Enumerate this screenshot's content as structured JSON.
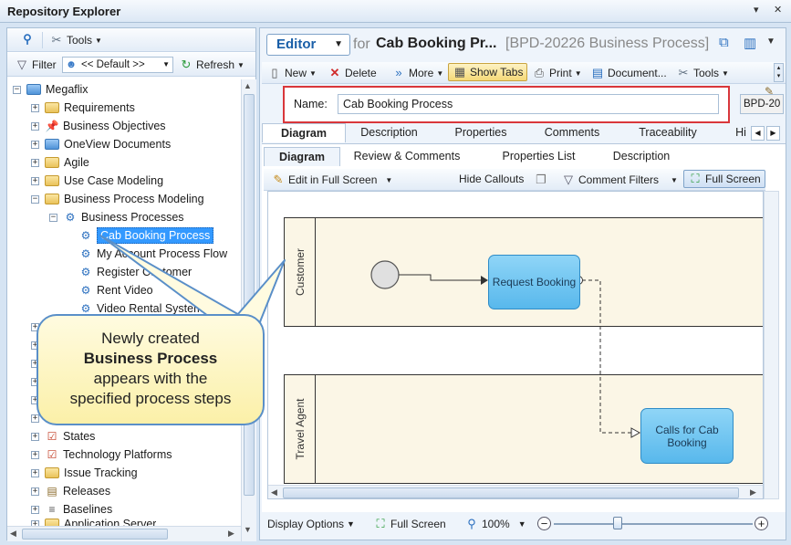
{
  "window": {
    "title": "Repository Explorer",
    "pin_icon": "chevron-down-icon",
    "close_icon": "close-icon"
  },
  "left_toolbar": {
    "search_icon": "search-icon",
    "tools_label": "Tools",
    "filter_label": "Filter",
    "filter_value": "<< Default >>",
    "refresh_label": "Refresh"
  },
  "tree": {
    "root": "Megaflix",
    "items": [
      {
        "label": "Requirements"
      },
      {
        "label": "Business Objectives"
      },
      {
        "label": "OneView Documents"
      },
      {
        "label": "Agile"
      },
      {
        "label": "Use Case Modeling"
      },
      {
        "label": "Business Process Modeling"
      },
      {
        "label": "Business Processes"
      },
      {
        "label": "Cab Booking Process"
      },
      {
        "label": "My Account Process Flow"
      },
      {
        "label": "Register Customer"
      },
      {
        "label": "Rent Video"
      },
      {
        "label": "Video Rental System"
      },
      {
        "label": "States"
      },
      {
        "label": "Technology Platforms"
      },
      {
        "label": "Issue Tracking"
      },
      {
        "label": "Releases"
      },
      {
        "label": "Baselines"
      },
      {
        "label": "Application Server"
      }
    ]
  },
  "callout": {
    "line1": "Newly created",
    "line2": "Business Process",
    "line3": "appears with the",
    "line4": "specified process steps"
  },
  "editor": {
    "mode_label": "Editor",
    "for_label": "for",
    "title": "Cab Booking Pr...",
    "id": "[BPD-20226 Business Process]",
    "toolbar": {
      "new": "New",
      "delete": "Delete",
      "more": "More",
      "show_tabs": "Show Tabs",
      "print": "Print",
      "document": "Document...",
      "tools": "Tools"
    },
    "name_label": "Name:",
    "name_value": "Cab Booking Process",
    "id_short": "BPD-20",
    "tabs": [
      "Diagram",
      "Description",
      "Properties",
      "Comments",
      "Traceability",
      "Hi"
    ],
    "subtabs": [
      "Diagram",
      "Review & Comments",
      "Properties List",
      "Description"
    ],
    "diagram_toolbar": {
      "edit_fullscreen": "Edit in Full Screen",
      "hide_callouts": "Hide Callouts",
      "comment_filters": "Comment Filters",
      "full_screen": "Full Screen"
    },
    "lanes": [
      "Customer",
      "Travel Agent"
    ],
    "tasks": [
      "Request Booking",
      "Calls for Cab Booking"
    ],
    "bottom": {
      "display_options": "Display Options",
      "full_screen": "Full Screen",
      "zoom": "100%"
    }
  },
  "colors": {
    "accent": "#2a6fbf",
    "highlight": "#3399ff",
    "callout_border": "#5a8fc8",
    "name_box_border": "#d9373b"
  }
}
